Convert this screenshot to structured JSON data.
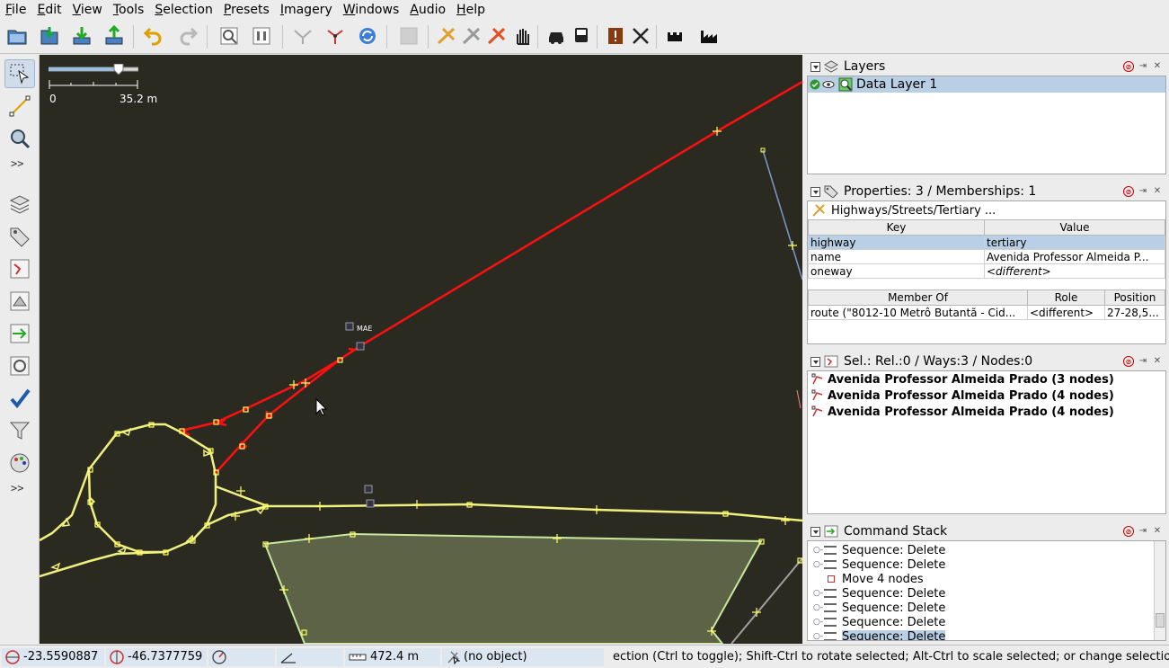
{
  "menubar": {
    "items": [
      "File",
      "Edit",
      "View",
      "Tools",
      "Selection",
      "Presets",
      "Imagery",
      "Windows",
      "Audio",
      "Help"
    ]
  },
  "toolbar": {
    "icons": [
      "open-icon",
      "save-icon",
      "download-icon",
      "upload-icon",
      "undo-icon",
      "redo-icon",
      "zoom-download-icon",
      "preferences-icon",
      "merge-icon",
      "split-icon",
      "refresh-icon",
      "disabled-icon",
      "highway-icon",
      "highway-alt-icon",
      "highway-red-icon",
      "hand-icon",
      "car-icon",
      "bus-icon",
      "warning-icon",
      "tools-icon",
      "castle-icon",
      "factory-icon"
    ]
  },
  "map": {
    "scale_start": "0",
    "scale_end": "35.2 m",
    "marker_label": "MAE"
  },
  "layers_panel": {
    "title": "Layers",
    "layers": [
      {
        "name": "Data Layer 1"
      }
    ]
  },
  "properties_panel": {
    "title": "Properties: 3 / Memberships: 1",
    "preset": "Highways/Streets/Tertiary ...",
    "headers": {
      "key": "Key",
      "value": "Value"
    },
    "rows": [
      {
        "key": "highway",
        "value": "tertiary"
      },
      {
        "key": "name",
        "value": "Avenida Professor Almeida P..."
      },
      {
        "key": "oneway",
        "value": "<different>"
      }
    ],
    "membership_headers": {
      "member_of": "Member Of",
      "role": "Role",
      "position": "Position"
    },
    "memberships": [
      {
        "member_of": "route (\"8012-10 Metrô Butantã - Cid...",
        "role": "<different>",
        "position": "27-28,5..."
      }
    ]
  },
  "selection_panel": {
    "title": "Sel.: Rel.:0 / Ways:3 / Nodes:0",
    "items": [
      "Avenida Professor Almeida Prado (3 nodes)",
      "Avenida Professor Almeida Prado (4 nodes)",
      "Avenida Professor Almeida Prado (4 nodes)"
    ]
  },
  "command_panel": {
    "title": "Command Stack",
    "items": [
      "Sequence: Delete",
      "Sequence: Delete",
      "Move 4 nodes",
      "Sequence: Delete",
      "Sequence: Delete",
      "Sequence: Delete",
      "Sequence: Delete"
    ]
  },
  "statusbar": {
    "lat": "-23.5590887",
    "lon": "-46.7377759",
    "distance": "472.4 m",
    "object": "(no object)",
    "message": "ection (Ctrl to toggle); Shift-Ctrl to rotate selected; Alt-Ctrl to scale selected; or change selection"
  },
  "colors": {
    "map_bg": "#2b2a21",
    "selected_way": "#ff0000",
    "road": "#f0f080",
    "area_fill": "#5c6346",
    "selection_bg": "#b8cfe5"
  }
}
